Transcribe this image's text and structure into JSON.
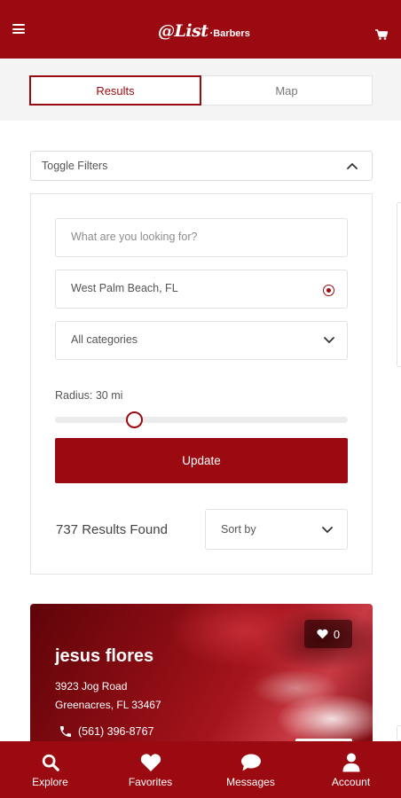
{
  "header": {
    "logo_script": "@List",
    "logo_sub": "Barbers",
    "menu_icon": "hamburger-menu-icon",
    "cart_icon": "shopping-cart-icon"
  },
  "tabs": [
    {
      "label": "Results",
      "active": true
    },
    {
      "label": "Map",
      "active": false
    }
  ],
  "filters": {
    "toggle_label": "Toggle Filters",
    "search_placeholder": "What are you looking for?",
    "location_value": "West Palm Beach, FL",
    "category_value": "All categories",
    "radius_label": "Radius: 30 mi",
    "radius_fraction": 0.27,
    "update_label": "Update"
  },
  "results": {
    "count_text": "737 Results Found",
    "sort_label": "Sort by"
  },
  "listing": {
    "name": "jesus flores",
    "address_line1": "3923 Jog Road",
    "address_line2": "Greenacres, FL 33467",
    "phone": "(561) 396-8767",
    "favorites_count": "0"
  },
  "bottom_nav": [
    {
      "label": "Explore",
      "icon": "search-icon"
    },
    {
      "label": "Favorites",
      "icon": "heart-icon"
    },
    {
      "label": "Messages",
      "icon": "chat-bubble-icon"
    },
    {
      "label": "Account",
      "icon": "user-icon"
    }
  ],
  "colors": {
    "brand": "#9b0a10",
    "background_band": "#f4f4f4",
    "border": "#e2e2e2"
  }
}
